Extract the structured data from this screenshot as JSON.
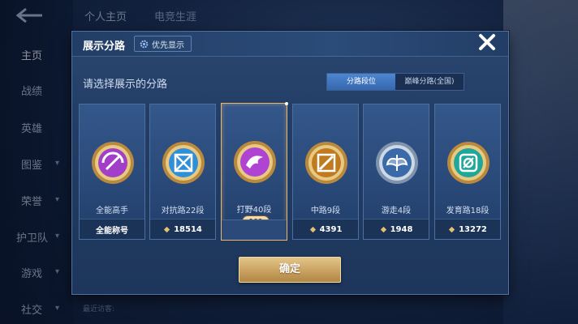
{
  "background": {
    "nav_items": [
      "主页",
      "战绩",
      "英雄",
      "图鉴",
      "荣誉",
      "护卫队",
      "游戏",
      "社交"
    ],
    "top_tabs": [
      "个人主页",
      "电竞生涯"
    ],
    "visitor_label": "最近访客:"
  },
  "modal": {
    "title": "展示分路",
    "priority_label": "优先显示",
    "subtitle": "请选择展示的分路",
    "segments": [
      "分路段位",
      "巅峰分路(全国)"
    ],
    "active_segment": 0,
    "confirm_label": "确定",
    "cards": [
      {
        "name": "全能高手",
        "stat": "全能称号",
        "emblem": "purple-shield-emblem",
        "selected": false,
        "show_diamond": false
      },
      {
        "name": "对抗路22段",
        "stat": "18514",
        "emblem": "blue-cross-emblem",
        "selected": false,
        "show_diamond": true
      },
      {
        "name": "打野40段",
        "stat": "",
        "emblem": "purple-dragon-emblem",
        "selected": true,
        "badge": "100",
        "show_diamond": false
      },
      {
        "name": "中路9段",
        "stat": "4391",
        "emblem": "gold-slash-emblem",
        "selected": false,
        "show_diamond": true
      },
      {
        "name": "游走4段",
        "stat": "1948",
        "emblem": "silver-wing-emblem",
        "selected": false,
        "show_diamond": true
      },
      {
        "name": "发育路18段",
        "stat": "13272",
        "emblem": "teal-target-emblem",
        "selected": false,
        "show_diamond": true
      }
    ]
  },
  "colors": {
    "accent_gold": "#c9a160",
    "selected_border": "#e6b870",
    "segment_active": "#3667ad"
  }
}
